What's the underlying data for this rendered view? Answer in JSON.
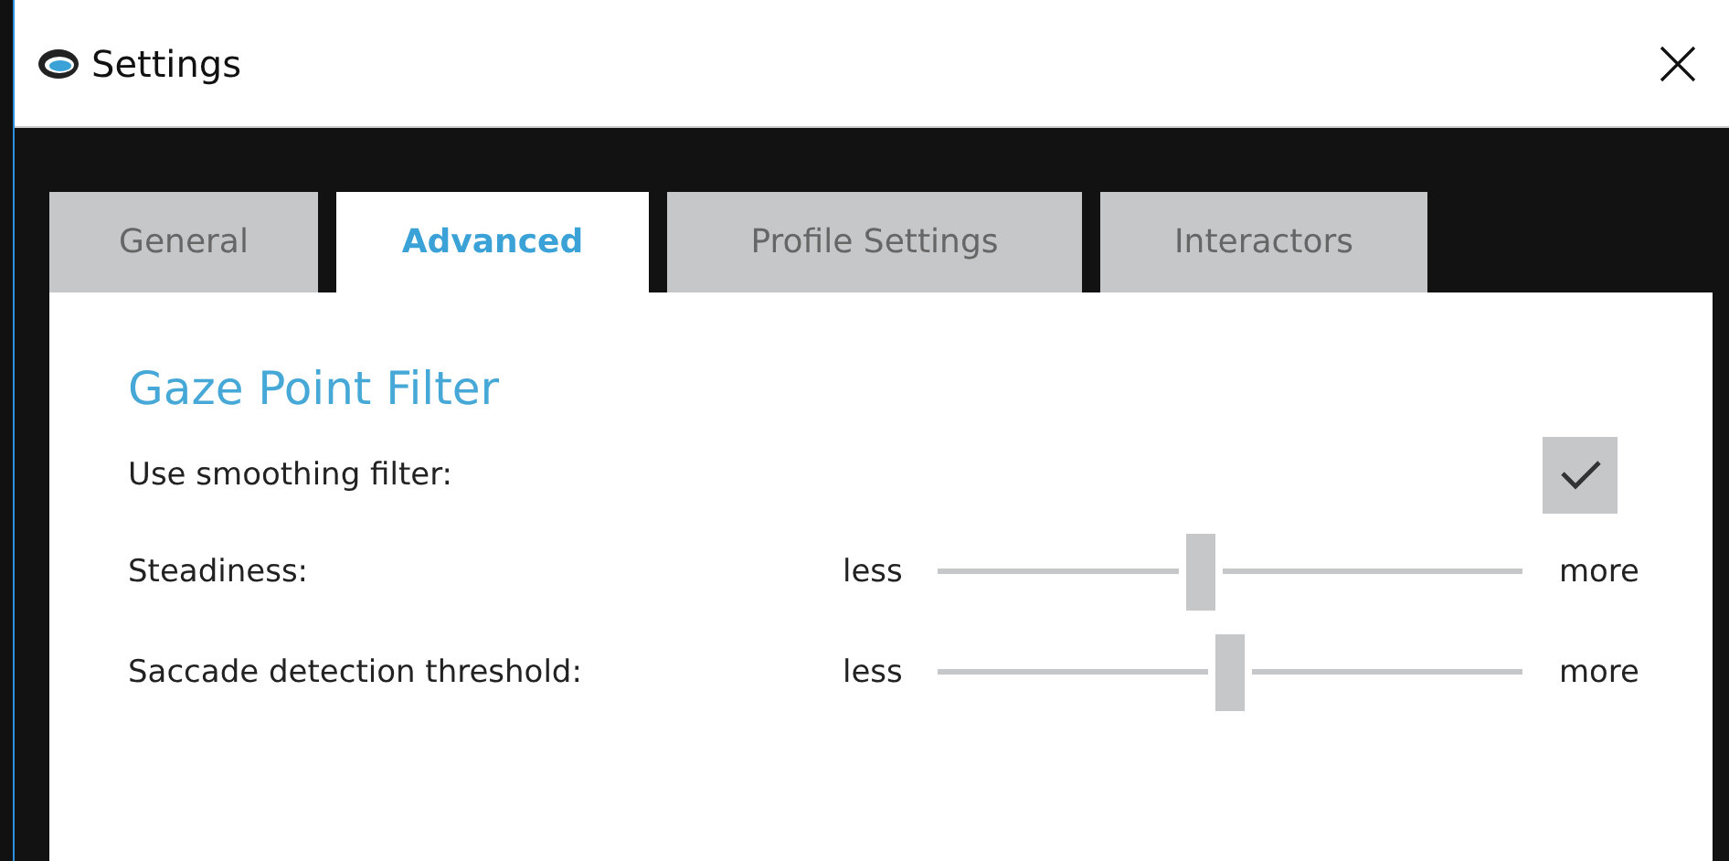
{
  "window": {
    "title": "Settings"
  },
  "tabs": [
    {
      "label": "General",
      "selected": false
    },
    {
      "label": "Advanced",
      "selected": true
    },
    {
      "label": "Profile Settings",
      "selected": false
    },
    {
      "label": "Interactors",
      "selected": false
    }
  ],
  "section": {
    "title": "Gaze Point Filter"
  },
  "settings": [
    {
      "kind": "checkbox",
      "label": "Use smoothing filter:",
      "checked": true
    },
    {
      "kind": "slider",
      "label": "Steadiness:",
      "min_label": "less",
      "max_label": "more",
      "level": 0.45
    },
    {
      "kind": "slider",
      "label": "Saccade detection threshold:",
      "min_label": "less",
      "max_label": "more",
      "level": 0.5
    }
  ]
}
